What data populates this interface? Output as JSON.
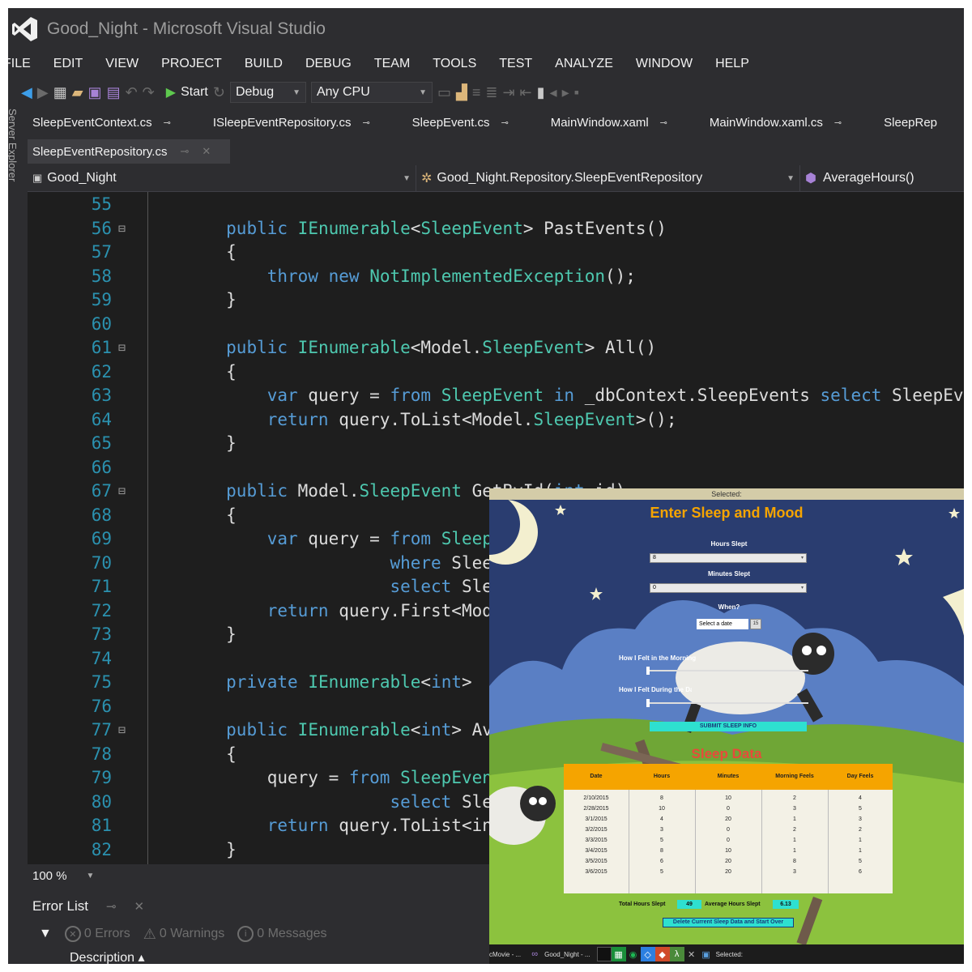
{
  "window": {
    "title": "Good_Night - Microsoft Visual Studio"
  },
  "menu": [
    "FILE",
    "EDIT",
    "VIEW",
    "PROJECT",
    "BUILD",
    "DEBUG",
    "TEAM",
    "TOOLS",
    "TEST",
    "ANALYZE",
    "WINDOW",
    "HELP"
  ],
  "toolbar": {
    "start_label": "Start",
    "config": "Debug",
    "platform": "Any CPU"
  },
  "side_panel_label": "Server Explorer",
  "pinned_tabs": [
    "SleepEventContext.cs",
    "ISleepEventRepository.cs",
    "SleepEvent.cs",
    "MainWindow.xaml",
    "MainWindow.xaml.cs",
    "SleepRep"
  ],
  "active_tab": "SleepEventRepository.cs",
  "navbar": {
    "project": "Good_Night",
    "type": "Good_Night.Repository.SleepEventRepository",
    "member": "AverageHours()"
  },
  "code_lines": [
    {
      "n": "55",
      "fold": "",
      "tokens": []
    },
    {
      "n": "56",
      "fold": "⊟",
      "tokens": [
        [
          "        ",
          ""
        ],
        [
          "public",
          "kw"
        ],
        [
          " ",
          ""
        ],
        [
          "IEnumerable",
          "ty"
        ],
        [
          "<",
          ""
        ],
        [
          "SleepEvent",
          "ty"
        ],
        [
          "> PastEvents()",
          ""
        ]
      ]
    },
    {
      "n": "57",
      "fold": "",
      "tokens": [
        [
          "        {",
          ""
        ]
      ]
    },
    {
      "n": "58",
      "fold": "",
      "tokens": [
        [
          "            ",
          ""
        ],
        [
          "throw",
          "kw"
        ],
        [
          " ",
          ""
        ],
        [
          "new",
          "kw"
        ],
        [
          " ",
          ""
        ],
        [
          "NotImplementedException",
          "ty"
        ],
        [
          "();",
          ""
        ]
      ]
    },
    {
      "n": "59",
      "fold": "",
      "tokens": [
        [
          "        }",
          ""
        ]
      ]
    },
    {
      "n": "60",
      "fold": "",
      "tokens": []
    },
    {
      "n": "61",
      "fold": "⊟",
      "tokens": [
        [
          "        ",
          ""
        ],
        [
          "public",
          "kw"
        ],
        [
          " ",
          ""
        ],
        [
          "IEnumerable",
          "ty"
        ],
        [
          "<Model.",
          ""
        ],
        [
          "SleepEvent",
          "ty"
        ],
        [
          "> All()",
          ""
        ]
      ]
    },
    {
      "n": "62",
      "fold": "",
      "tokens": [
        [
          "        {",
          ""
        ]
      ]
    },
    {
      "n": "63",
      "fold": "",
      "tokens": [
        [
          "            ",
          ""
        ],
        [
          "var",
          "kw"
        ],
        [
          " query = ",
          ""
        ],
        [
          "from",
          "kw"
        ],
        [
          " ",
          ""
        ],
        [
          "SleepEvent",
          "ty"
        ],
        [
          " ",
          ""
        ],
        [
          "in",
          "kw"
        ],
        [
          " _dbContext.SleepEvents ",
          ""
        ],
        [
          "select",
          "kw"
        ],
        [
          " SleepEvent;",
          ""
        ]
      ]
    },
    {
      "n": "64",
      "fold": "",
      "tokens": [
        [
          "            ",
          ""
        ],
        [
          "return",
          "kw"
        ],
        [
          " query.ToList<Model.",
          ""
        ],
        [
          "SleepEvent",
          "ty"
        ],
        [
          ">();",
          ""
        ]
      ]
    },
    {
      "n": "65",
      "fold": "",
      "tokens": [
        [
          "        }",
          ""
        ]
      ]
    },
    {
      "n": "66",
      "fold": "",
      "tokens": []
    },
    {
      "n": "67",
      "fold": "⊟",
      "tokens": [
        [
          "        ",
          ""
        ],
        [
          "public",
          "kw"
        ],
        [
          " Model.",
          ""
        ],
        [
          "SleepEvent",
          "ty"
        ],
        [
          " GetById(",
          ""
        ],
        [
          "int",
          "kw"
        ],
        [
          " id)",
          ""
        ]
      ]
    },
    {
      "n": "68",
      "fold": "",
      "tokens": [
        [
          "        {",
          ""
        ]
      ]
    },
    {
      "n": "69",
      "fold": "",
      "tokens": [
        [
          "            ",
          ""
        ],
        [
          "var",
          "kw"
        ],
        [
          " query = ",
          ""
        ],
        [
          "from",
          "kw"
        ],
        [
          " ",
          ""
        ],
        [
          "SleepEvent",
          "ty"
        ]
      ]
    },
    {
      "n": "70",
      "fold": "",
      "tokens": [
        [
          "                        ",
          ""
        ],
        [
          "where",
          "kw"
        ],
        [
          " SleepEvent",
          ""
        ]
      ]
    },
    {
      "n": "71",
      "fold": "",
      "tokens": [
        [
          "                        ",
          ""
        ],
        [
          "select",
          "kw"
        ],
        [
          " SleepEvent",
          ""
        ]
      ]
    },
    {
      "n": "72",
      "fold": "",
      "tokens": [
        [
          "            ",
          ""
        ],
        [
          "return",
          "kw"
        ],
        [
          " query.First<Model>",
          ""
        ]
      ]
    },
    {
      "n": "73",
      "fold": "",
      "tokens": [
        [
          "        }",
          ""
        ]
      ]
    },
    {
      "n": "74",
      "fold": "",
      "tokens": []
    },
    {
      "n": "75",
      "fold": "",
      "tokens": [
        [
          "        ",
          ""
        ],
        [
          "private",
          "kw"
        ],
        [
          " ",
          ""
        ],
        [
          "IEnumerable",
          "ty"
        ],
        [
          "<",
          ""
        ],
        [
          "int",
          "kw"
        ],
        [
          "> ",
          ""
        ]
      ]
    },
    {
      "n": "76",
      "fold": "",
      "tokens": []
    },
    {
      "n": "77",
      "fold": "⊟",
      "tokens": [
        [
          "        ",
          ""
        ],
        [
          "public",
          "kw"
        ],
        [
          " ",
          ""
        ],
        [
          "IEnumerable",
          "ty"
        ],
        [
          "<",
          ""
        ],
        [
          "int",
          "kw"
        ],
        [
          "> AverageHours()",
          ""
        ]
      ]
    },
    {
      "n": "78",
      "fold": "",
      "tokens": [
        [
          "        {",
          ""
        ]
      ]
    },
    {
      "n": "79",
      "fold": "",
      "tokens": [
        [
          "            query = ",
          ""
        ],
        [
          "from",
          "kw"
        ],
        [
          " ",
          ""
        ],
        [
          "SleepEvent",
          "ty"
        ]
      ]
    },
    {
      "n": "80",
      "fold": "",
      "tokens": [
        [
          "                        ",
          ""
        ],
        [
          "select",
          "kw"
        ],
        [
          " SleepEvent",
          ""
        ]
      ]
    },
    {
      "n": "81",
      "fold": "",
      "tokens": [
        [
          "            ",
          ""
        ],
        [
          "return",
          "kw"
        ],
        [
          " query.ToList<int>",
          ""
        ]
      ]
    },
    {
      "n": "82",
      "fold": "",
      "tokens": [
        [
          "        }",
          ""
        ]
      ]
    }
  ],
  "zoom": "100 %",
  "error_list": {
    "title": "Error List",
    "errors": "0 Errors",
    "warnings": "0 Warnings",
    "messages": "0 Messages",
    "description_header": "Description"
  },
  "app": {
    "top_label": "Selected:",
    "title": "Enter Sleep and Mood",
    "hours_label": "Hours Slept",
    "hours_value": "8",
    "minutes_label": "Minutes Slept",
    "minutes_value": "0",
    "when_label": "When?",
    "date_placeholder": "Select a date",
    "date_icon": "15",
    "morning_label": "How I Felt in the Morning",
    "day_label": "How I Felt During the Day",
    "submit_label": "SUBMIT SLEEP INFO",
    "sleep_data_title": "Sleep Data",
    "table_headers": [
      "Date",
      "Hours",
      "Minutes",
      "Morning Feels",
      "Day Feels"
    ],
    "table_rows": [
      [
        "2/10/2015",
        "8",
        "10",
        "2",
        "4"
      ],
      [
        "2/28/2015",
        "10",
        "0",
        "3",
        "5"
      ],
      [
        "3/1/2015",
        "4",
        "20",
        "1",
        "3"
      ],
      [
        "3/2/2015",
        "3",
        "0",
        "2",
        "2"
      ],
      [
        "3/3/2015",
        "5",
        "0",
        "1",
        "1"
      ],
      [
        "3/4/2015",
        "8",
        "10",
        "1",
        "1"
      ],
      [
        "3/5/2015",
        "6",
        "20",
        "8",
        "5"
      ],
      [
        "3/6/2015",
        "5",
        "20",
        "3",
        "6"
      ]
    ],
    "total_label": "Total Hours Slept",
    "total_value": "49",
    "average_label": "Average Hours Slept",
    "average_value": "6.13",
    "delete_label": "Delete Current Sleep Data and Start Over",
    "taskbar": {
      "item1": "cMovie - ...",
      "item2": "Good_Night - ...",
      "item3": "Selected:"
    }
  }
}
